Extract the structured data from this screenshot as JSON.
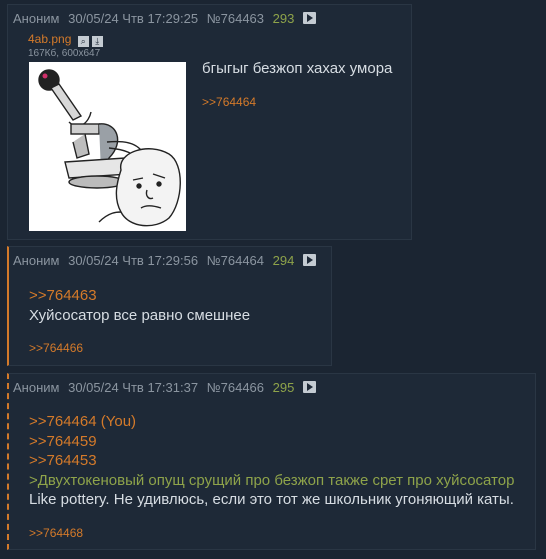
{
  "posts": [
    {
      "author": "Аноним",
      "date": "30/05/24 Чтв 17:29:25",
      "id": "№764463",
      "num": "293",
      "file": {
        "name": "4ab.png",
        "meta": "167Кб, 600x647"
      },
      "text": "бгыгыг безжоп хахах умора",
      "replies": [
        ">>764464"
      ]
    },
    {
      "author": "Аноним",
      "date": "30/05/24 Чтв 17:29:56",
      "id": "№764464",
      "num": "294",
      "lines": [
        ">>764463"
      ],
      "text": "Хуйсосатор все равно смешнее",
      "replies": [
        ">>764466"
      ]
    },
    {
      "author": "Аноним",
      "date": "30/05/24 Чтв 17:31:37",
      "id": "№764466",
      "num": "295",
      "lines": [
        ">>764464 (You)",
        ">>764459",
        ">>764453"
      ],
      "greentext": ">Двухтокеновый опущ срущий про безжоп также срет про хуйсосатор",
      "text": "Like pottery. Не удивлюсь, если это тот же школьник угоняющий каты.",
      "replies": [
        ">>764468"
      ]
    }
  ]
}
